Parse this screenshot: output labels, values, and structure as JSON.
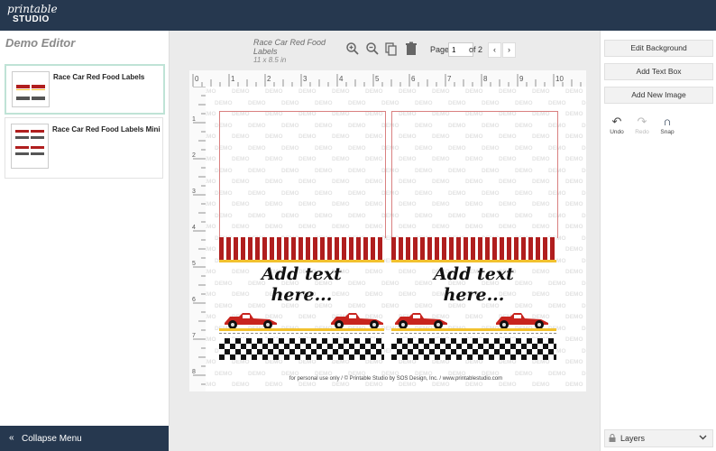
{
  "app": {
    "logo_line1": "printable",
    "logo_line2": "STUDIO"
  },
  "left_panel": {
    "title": "Demo Editor",
    "projects": [
      {
        "name": "Race Car Red Food Labels",
        "selected": true
      },
      {
        "name": "Race Car Red Food Labels Mini",
        "selected": false
      }
    ],
    "collapse_icon": "double-chevron-left-icon",
    "collapse_label": "Collapse Menu"
  },
  "toolbar": {
    "doc_name": "Race Car Red Food Labels",
    "doc_size": "11 x 8.5 in",
    "icons": [
      "zoom-in-icon",
      "zoom-out-icon",
      "duplicate-icon",
      "trash-icon"
    ],
    "page_label": "Page",
    "page_value": "1",
    "of_label": "of 2",
    "prev_glyph": "‹",
    "next_glyph": "›"
  },
  "ruler": {
    "h_ticks": [
      "0",
      "1",
      "2",
      "3",
      "4",
      "5",
      "6",
      "7",
      "8",
      "9",
      "10"
    ],
    "v_ticks": [
      "1",
      "2",
      "3",
      "4",
      "5",
      "6",
      "7",
      "8"
    ]
  },
  "canvas": {
    "watermark": "DEMO",
    "labels": [
      {
        "text_line1": "Add text",
        "text_line2": "here..."
      },
      {
        "text_line1": "Add text",
        "text_line2": "here..."
      }
    ],
    "footer": "for personal use only / © Printable Studio by SOS Design, Inc. / www.printablestudio.com",
    "colors": {
      "stripe": "#b01e1e",
      "accent_yellow": "#f2c12e",
      "car": "#c8241e"
    }
  },
  "right_panel": {
    "buttons": [
      "Edit Background",
      "Add Text Box",
      "Add New Image"
    ],
    "tools": [
      {
        "label": "Undo",
        "icon": "undo-icon",
        "glyph": "↶",
        "enabled": true
      },
      {
        "label": "Redo",
        "icon": "redo-icon",
        "glyph": "↷",
        "enabled": false
      },
      {
        "label": "Snap",
        "icon": "magnet-icon",
        "glyph": "∩",
        "enabled": true
      }
    ],
    "layers_label": "Layers",
    "layers_icon": "lock-icon"
  }
}
